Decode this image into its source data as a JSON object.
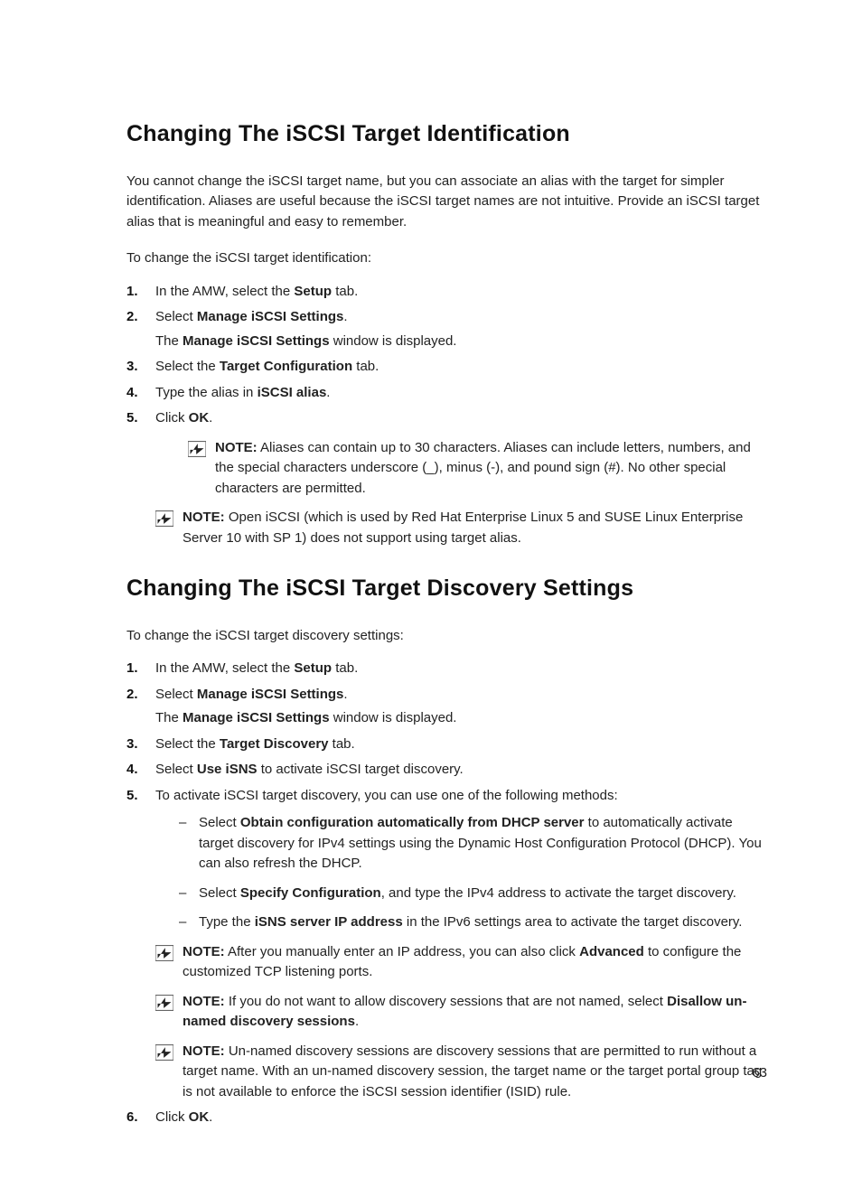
{
  "section1": {
    "title": "Changing The iSCSI Target Identification",
    "intro": "You cannot change the iSCSI target name, but you can associate an alias with the target for simpler identification. Aliases are useful because the iSCSI target names are not intuitive. Provide an iSCSI target alias that is meaningful and easy to remember.",
    "lead": "To change the iSCSI target identification:",
    "steps": {
      "s1_pre": "In the AMW, select the ",
      "s1_b": "Setup",
      "s1_post": " tab.",
      "s2_pre": "Select ",
      "s2_b": "Manage iSCSI Settings",
      "s2_post": ".",
      "s2_sub_pre": "The ",
      "s2_sub_b": "Manage iSCSI Settings",
      "s2_sub_post": " window is displayed.",
      "s3_pre": "Select the ",
      "s3_b": "Target Configuration",
      "s3_post": " tab.",
      "s4_pre": "Type the alias in ",
      "s4_b": "iSCSI alias",
      "s4_post": ".",
      "s5_pre": "Click ",
      "s5_b": "OK",
      "s5_post": "."
    },
    "note1_label": "NOTE:",
    "note1_text": " Aliases can contain up to 30 characters. Aliases can include letters, numbers, and the special characters underscore (_), minus (-), and pound sign (#). No other special characters are permitted.",
    "note2_label": "NOTE:",
    "note2_text": " Open iSCSI (which is used by Red Hat Enterprise Linux 5 and SUSE Linux Enterprise Server 10 with SP 1) does not support using target alias."
  },
  "section2": {
    "title": "Changing The iSCSI Target Discovery Settings",
    "lead": "To change the iSCSI target discovery settings:",
    "steps": {
      "s1_pre": "In the AMW, select the ",
      "s1_b": "Setup",
      "s1_post": " tab.",
      "s2_pre": "Select ",
      "s2_b": "Manage iSCSI Settings",
      "s2_post": ".",
      "s2_sub_pre": "The ",
      "s2_sub_b": "Manage iSCSI Settings",
      "s2_sub_post": " window is displayed.",
      "s3_pre": "Select the ",
      "s3_b": "Target Discovery",
      "s3_post": " tab.",
      "s4_pre": "Select ",
      "s4_b": "Use iSNS",
      "s4_post": " to activate iSCSI target discovery.",
      "s5_text": "To activate iSCSI target discovery, you can use one of the following methods:",
      "sub1_pre": "Select ",
      "sub1_b": "Obtain configuration automatically from DHCP server",
      "sub1_post": " to automatically activate target discovery for IPv4 settings using the Dynamic Host Configuration Protocol (DHCP). You can also refresh the DHCP.",
      "sub2_pre": "Select ",
      "sub2_b": "Specify Configuration",
      "sub2_post": ", and type the IPv4 address to activate the target discovery.",
      "sub3_pre": "Type the ",
      "sub3_b": "iSNS server IP address",
      "sub3_post": " in the IPv6 settings area to activate the target discovery.",
      "s6_pre": "Click ",
      "s6_b": "OK",
      "s6_post": "."
    },
    "noteA_label": "NOTE:",
    "noteA_pre": " After you manually enter an IP address, you can also click ",
    "noteA_b": "Advanced",
    "noteA_post": " to configure the customized TCP listening ports.",
    "noteB_label": "NOTE:",
    "noteB_pre": " If you do not want to allow discovery sessions that are not named, select ",
    "noteB_b": "Disallow un-named discovery sessions",
    "noteB_post": ".",
    "noteC_label": "NOTE:",
    "noteC_text": " Un-named discovery sessions are discovery sessions that are permitted to run without a target name. With an un-named discovery session, the target name or the target portal group tag is not available to enforce the iSCSI session identifier (ISID) rule."
  },
  "pageNumber": "63"
}
